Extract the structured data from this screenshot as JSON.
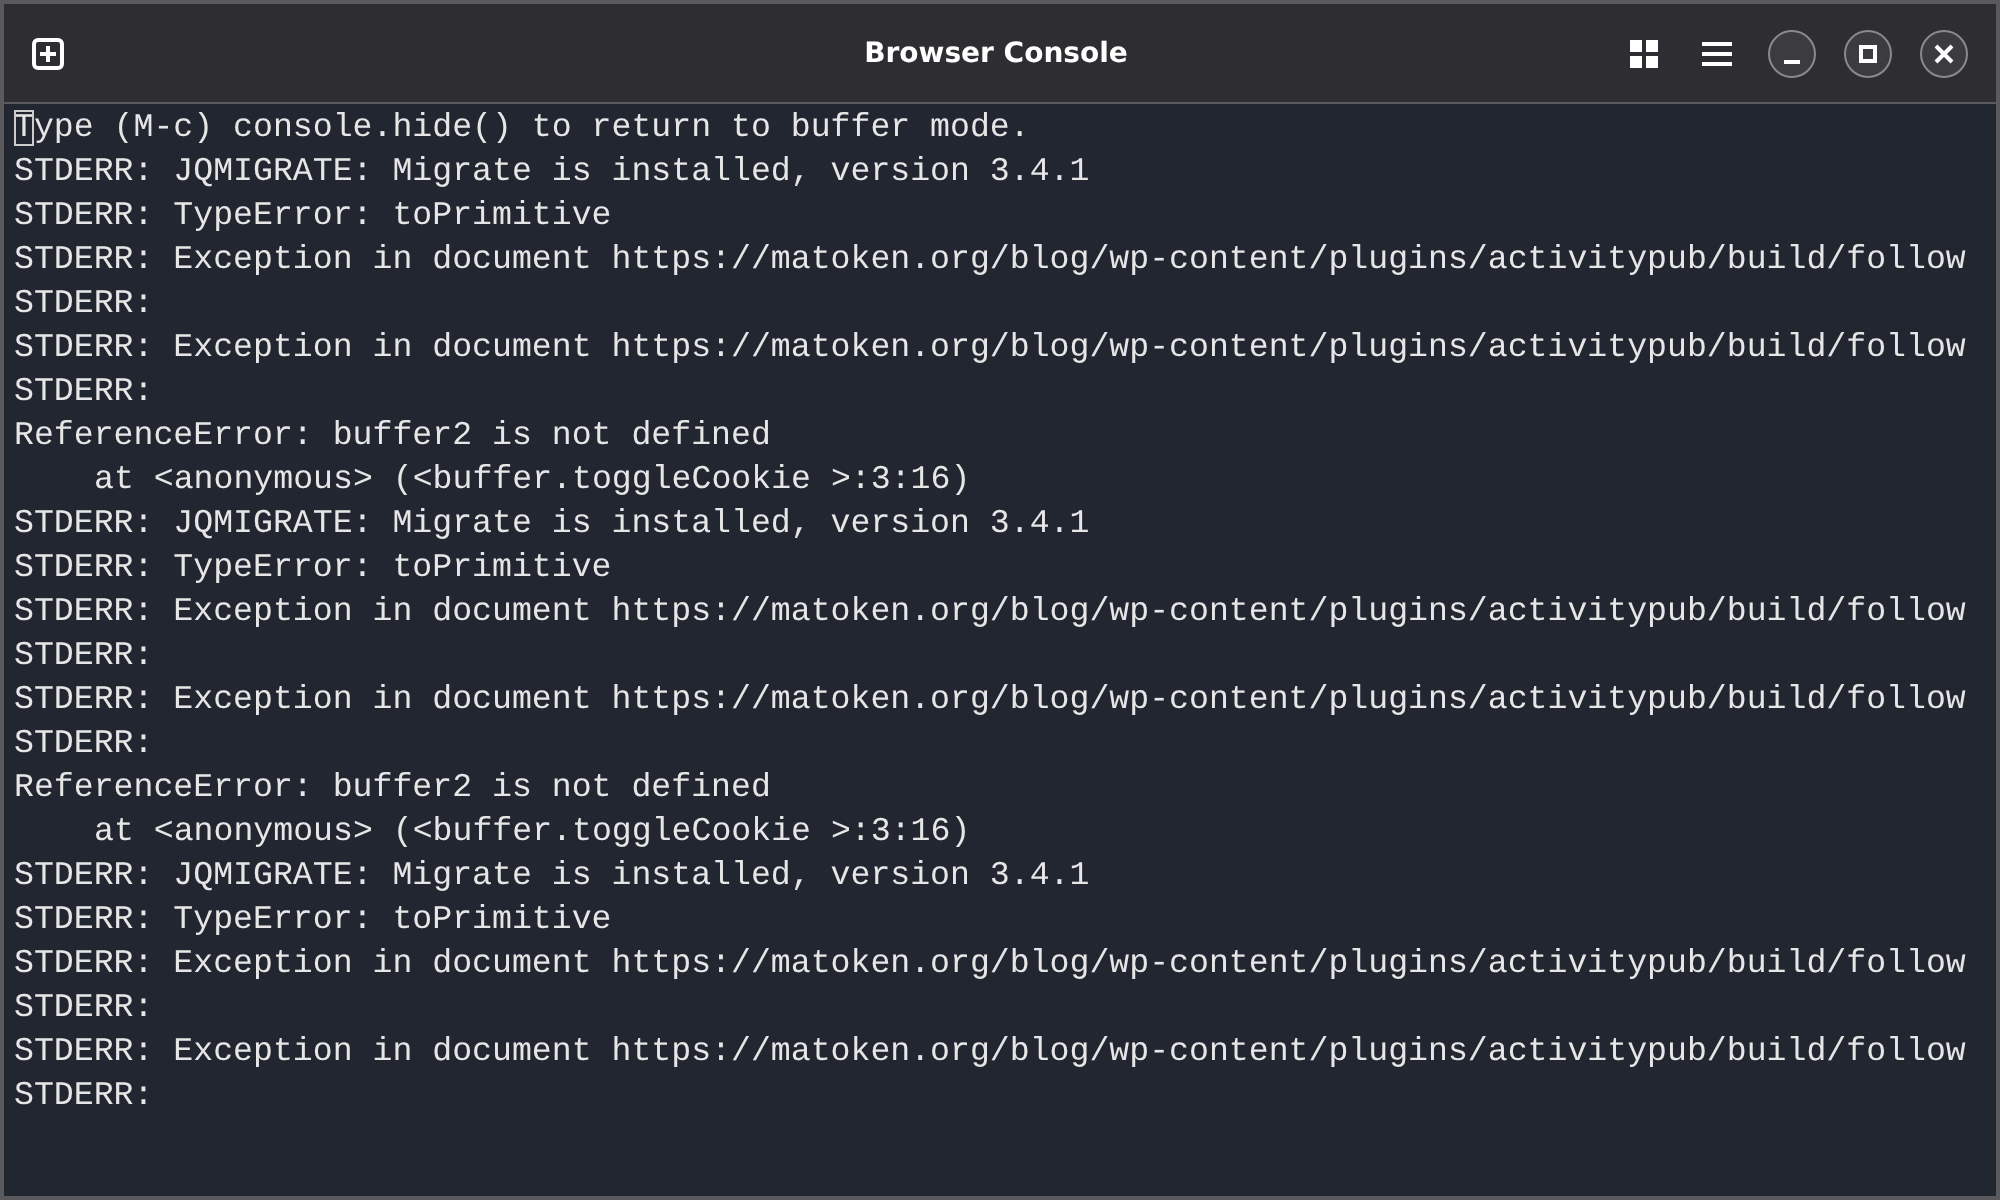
{
  "window": {
    "title": "Browser Console"
  },
  "lines": [
    {
      "text": "Type (M-c) console.hide() to return to buffer mode.",
      "kind": "info",
      "cursor": true
    },
    {
      "text": "STDERR: JQMIGRATE: Migrate is installed, version 3.4.1",
      "kind": "info",
      "cursor": false
    },
    {
      "text": "STDERR: TypeError: toPrimitive",
      "kind": "info",
      "cursor": false
    },
    {
      "text": "STDERR: Exception in document https://matoken.org/blog/wp-content/plugins/activitypub/build/follow",
      "kind": "info",
      "cursor": false
    },
    {
      "text": "STDERR:",
      "kind": "info",
      "cursor": false
    },
    {
      "text": "STDERR: Exception in document https://matoken.org/blog/wp-content/plugins/activitypub/build/follow",
      "kind": "info",
      "cursor": false
    },
    {
      "text": "STDERR:",
      "kind": "info",
      "cursor": false
    },
    {
      "text": "ReferenceError: buffer2 is not defined",
      "kind": "info",
      "cursor": false
    },
    {
      "text": "at <anonymous> (<buffer.toggleCookie >:3:16)",
      "kind": "trace",
      "cursor": false
    },
    {
      "text": "STDERR: JQMIGRATE: Migrate is installed, version 3.4.1",
      "kind": "info",
      "cursor": false
    },
    {
      "text": "STDERR: TypeError: toPrimitive",
      "kind": "info",
      "cursor": false
    },
    {
      "text": "STDERR: Exception in document https://matoken.org/blog/wp-content/plugins/activitypub/build/follow",
      "kind": "info",
      "cursor": false
    },
    {
      "text": "STDERR:",
      "kind": "info",
      "cursor": false
    },
    {
      "text": "STDERR: Exception in document https://matoken.org/blog/wp-content/plugins/activitypub/build/follow",
      "kind": "info",
      "cursor": false
    },
    {
      "text": "STDERR:",
      "kind": "info",
      "cursor": false
    },
    {
      "text": "ReferenceError: buffer2 is not defined",
      "kind": "info",
      "cursor": false
    },
    {
      "text": "at <anonymous> (<buffer.toggleCookie >:3:16)",
      "kind": "trace",
      "cursor": false
    },
    {
      "text": "STDERR: JQMIGRATE: Migrate is installed, version 3.4.1",
      "kind": "info",
      "cursor": false
    },
    {
      "text": "STDERR: TypeError: toPrimitive",
      "kind": "info",
      "cursor": false
    },
    {
      "text": "STDERR: Exception in document https://matoken.org/blog/wp-content/plugins/activitypub/build/follow",
      "kind": "info",
      "cursor": false
    },
    {
      "text": "STDERR:",
      "kind": "info",
      "cursor": false
    },
    {
      "text": "STDERR: Exception in document https://matoken.org/blog/wp-content/plugins/activitypub/build/follow",
      "kind": "info",
      "cursor": false
    },
    {
      "text": "STDERR:",
      "kind": "info",
      "cursor": false
    }
  ]
}
